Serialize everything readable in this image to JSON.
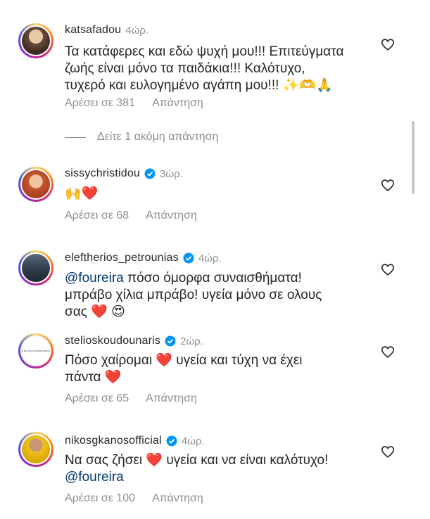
{
  "comments": [
    {
      "username": "katsafadou",
      "time": "4ώρ.",
      "verified": false,
      "lines": [
        "Τα κατάφερες και εδώ ψυχή μου!!! Επιτεύγματα",
        "ζωής είναι μόνο τα παιδάκια!!! Καλότυχο,",
        "τυχερό και ευλογημένο αγάπη μου!!! ✨🫶🙏"
      ],
      "likes": "Αρέσει σε 381",
      "reply": "Απάντηση"
    },
    {
      "username": "sissychristidou",
      "time": "3ώρ.",
      "verified": true,
      "lines": [
        "🙌❤️"
      ],
      "likes": "Αρέσει σε 68",
      "reply": "Απάντηση"
    },
    {
      "username": "eleftherios_petrounias",
      "time": "4ώρ.",
      "verified": true,
      "mention": "@foureira",
      "lines": [
        " πόσο όμορφα συναισθήματα!",
        "μπράβο χίλια μπράβο! υγεία μόνο σε ολους",
        "σας ❤️ 😍"
      ]
    },
    {
      "username": "stelioskoudounaris",
      "time": "2ώρ.",
      "verified": true,
      "lines": [
        "Πόσο χαίρομαι ❤️ υγεία και τύχη να έχει",
        "πάντα ❤️"
      ],
      "likes": "Αρέσει σε 65",
      "reply": "Απάντηση"
    },
    {
      "username": "nikosgkanosofficial",
      "time": "4ώρ.",
      "verified": true,
      "lines": [
        "Να σας ζήσει ❤️ υγεία και να είναι καλότυχο!"
      ],
      "mention_line": "@foureira",
      "likes": "Αρέσει σε 100",
      "reply": "Απάντηση"
    }
  ],
  "view_more": "Δείτε 1 ακόμη απάντηση",
  "avatar_brand_text": "STELIOS KOUDOUNARIS",
  "colors": {
    "username": "#262626",
    "meta": "#8e8e8e",
    "mention": "#00376b",
    "verified": "#0095f6"
  }
}
